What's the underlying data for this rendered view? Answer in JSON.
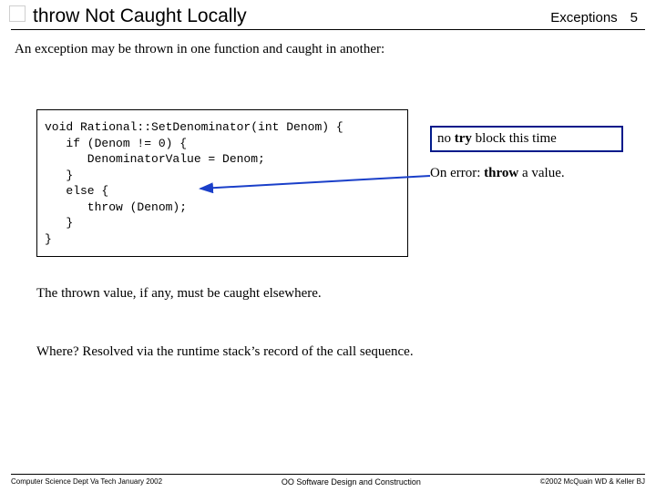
{
  "header": {
    "title": "throw Not Caught Locally",
    "topic": "Exceptions",
    "page_num": "5"
  },
  "intro": "An exception may be thrown in one function and caught in another:",
  "code": "void Rational::SetDenominator(int Denom) {\n   if (Denom != 0) {\n      DenominatorValue = Denom;\n   }\n   else {\n      throw (Denom);\n   }\n}",
  "note1_prefix": "no ",
  "note1_bold": "try",
  "note1_suffix": " block this time",
  "note2_prefix": "On error: ",
  "note2_bold": "throw",
  "note2_suffix": " a value.",
  "mid1": "The thrown value, if any, must be caught elsewhere.",
  "mid2": "Where?  Resolved via the runtime stack’s record of the call sequence.",
  "footer": {
    "left": "Computer Science Dept Va Tech January 2002",
    "center": "OO Software Design and Construction",
    "right": "©2002 McQuain WD & Keller BJ"
  }
}
